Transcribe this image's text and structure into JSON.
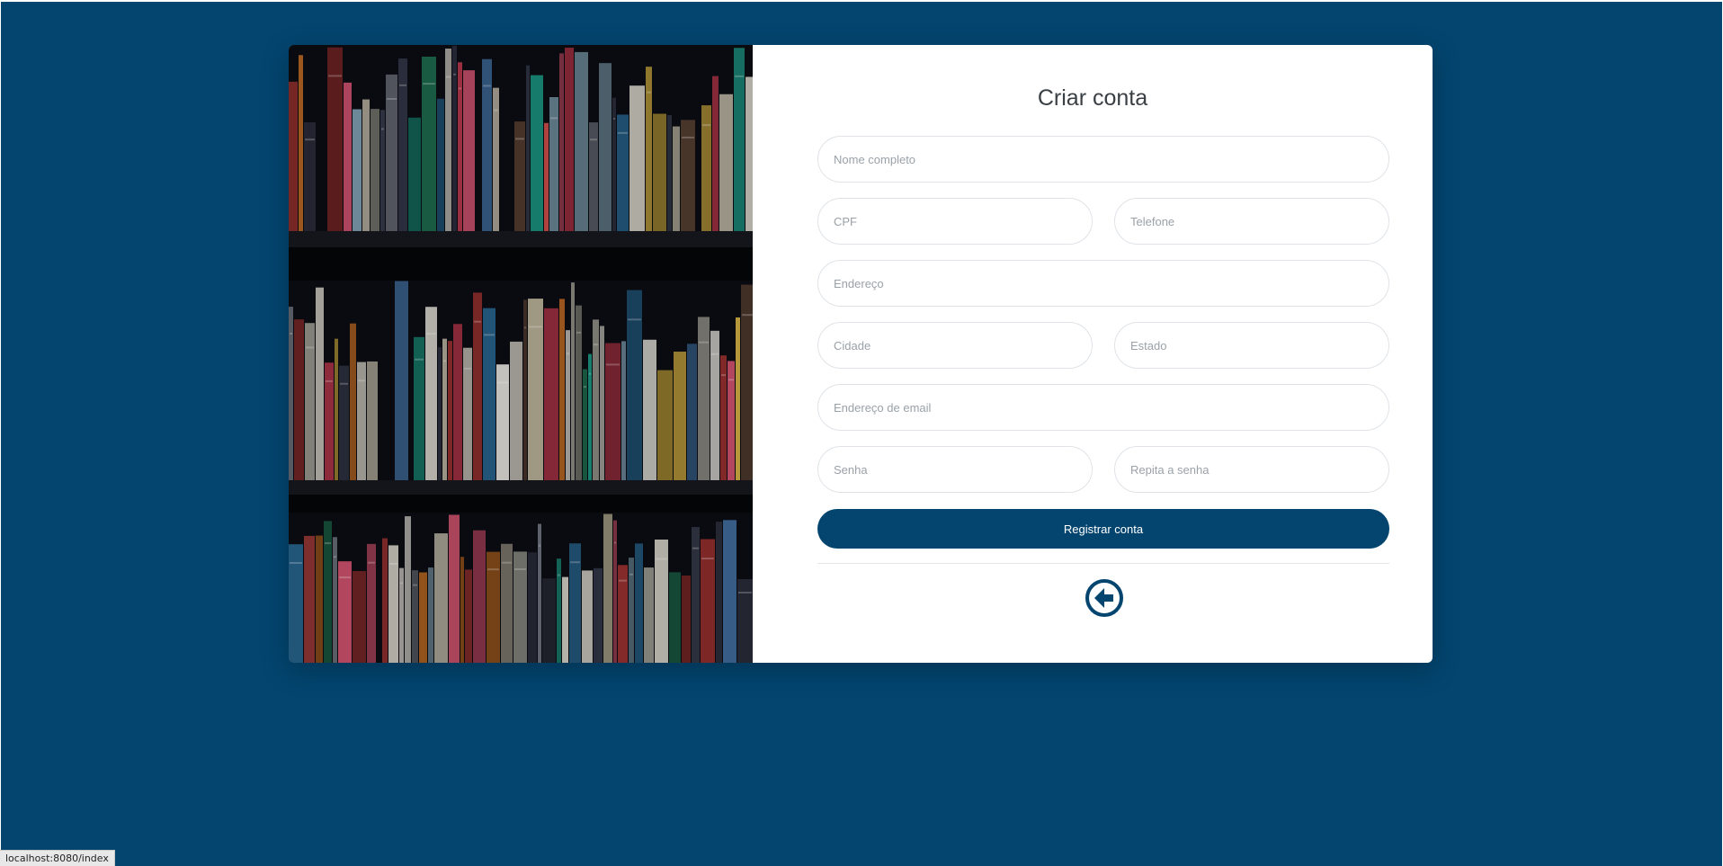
{
  "form": {
    "title": "Criar conta",
    "fields": {
      "full_name": {
        "placeholder": "Nome completo",
        "value": ""
      },
      "cpf": {
        "placeholder": "CPF",
        "value": ""
      },
      "phone": {
        "placeholder": "Telefone",
        "value": ""
      },
      "address": {
        "placeholder": "Endereço",
        "value": ""
      },
      "city": {
        "placeholder": "Cidade",
        "value": ""
      },
      "state": {
        "placeholder": "Estado",
        "value": ""
      },
      "email": {
        "placeholder": "Endereço de email",
        "value": ""
      },
      "password": {
        "placeholder": "Senha",
        "value": ""
      },
      "password_repeat": {
        "placeholder": "Repita a senha",
        "value": ""
      }
    },
    "register_label": "Registrar conta",
    "back_icon": "arrow-left-circle-icon"
  },
  "status_bar": {
    "url": "localhost:8080/index"
  },
  "colors": {
    "page_background": "#03456f",
    "primary": "#03456f",
    "card_background": "#ffffff",
    "field_border": "#dfe3e7",
    "placeholder_text": "#9aa1a8"
  },
  "image": {
    "subject": "bookshelf-photo"
  }
}
